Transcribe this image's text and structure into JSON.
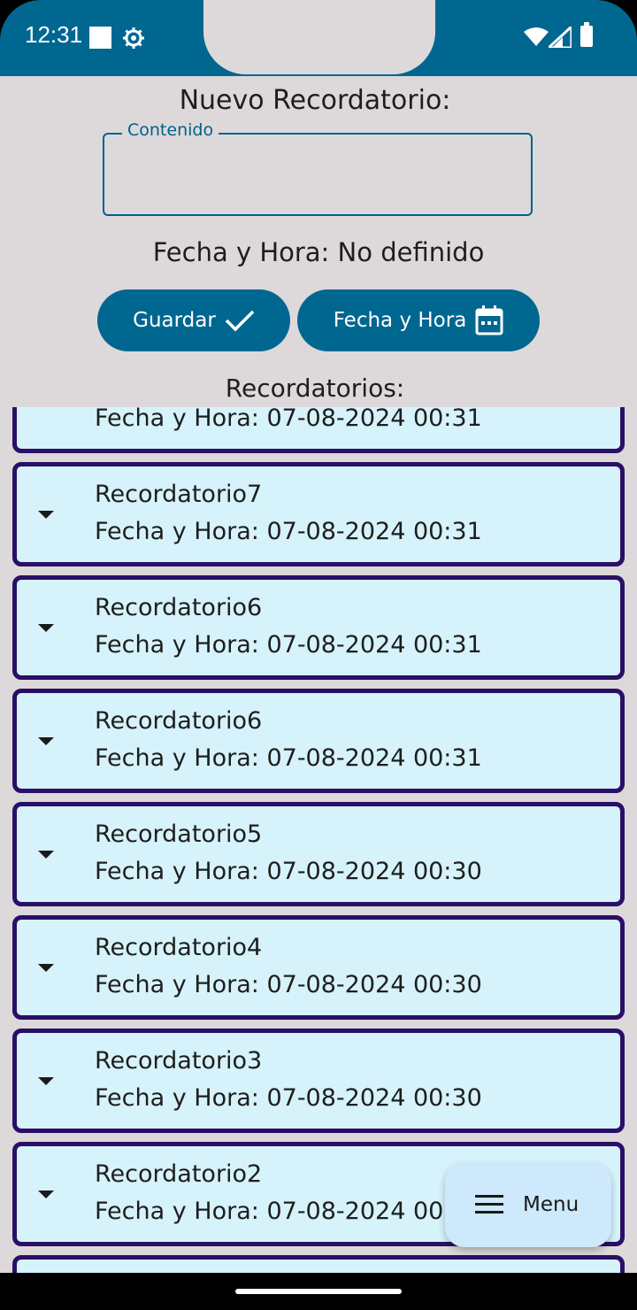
{
  "status_bar": {
    "time": "12:31"
  },
  "form": {
    "title": "Nuevo Recordatorio:",
    "content_label": "Contenido",
    "content_value": "",
    "datetime_text": "Fecha y Hora: No definido",
    "save_label": "Guardar",
    "date_label": "Fecha y Hora"
  },
  "section_title": "Recordatorios:",
  "reminders": [
    {
      "name": "",
      "datetime": "Fecha y Hora: 07-08-2024 00:31"
    },
    {
      "name": "Recordatorio7",
      "datetime": "Fecha y Hora: 07-08-2024 00:31"
    },
    {
      "name": "Recordatorio6",
      "datetime": "Fecha y Hora: 07-08-2024 00:31"
    },
    {
      "name": "Recordatorio6",
      "datetime": "Fecha y Hora: 07-08-2024 00:31"
    },
    {
      "name": "Recordatorio5",
      "datetime": "Fecha y Hora: 07-08-2024 00:30"
    },
    {
      "name": "Recordatorio4",
      "datetime": "Fecha y Hora: 07-08-2024 00:30"
    },
    {
      "name": "Recordatorio3",
      "datetime": "Fecha y Hora: 07-08-2024 00:30"
    },
    {
      "name": "Recordatorio2",
      "datetime": "Fecha y Hora: 07-08-2024 00:30"
    }
  ],
  "fab": {
    "label": "Menu"
  },
  "colors": {
    "primary": "#006791",
    "card_bg": "#d6f2fb",
    "card_border": "#2a0f66",
    "background": "#ddd9da",
    "fab_bg": "#cde9fb"
  }
}
